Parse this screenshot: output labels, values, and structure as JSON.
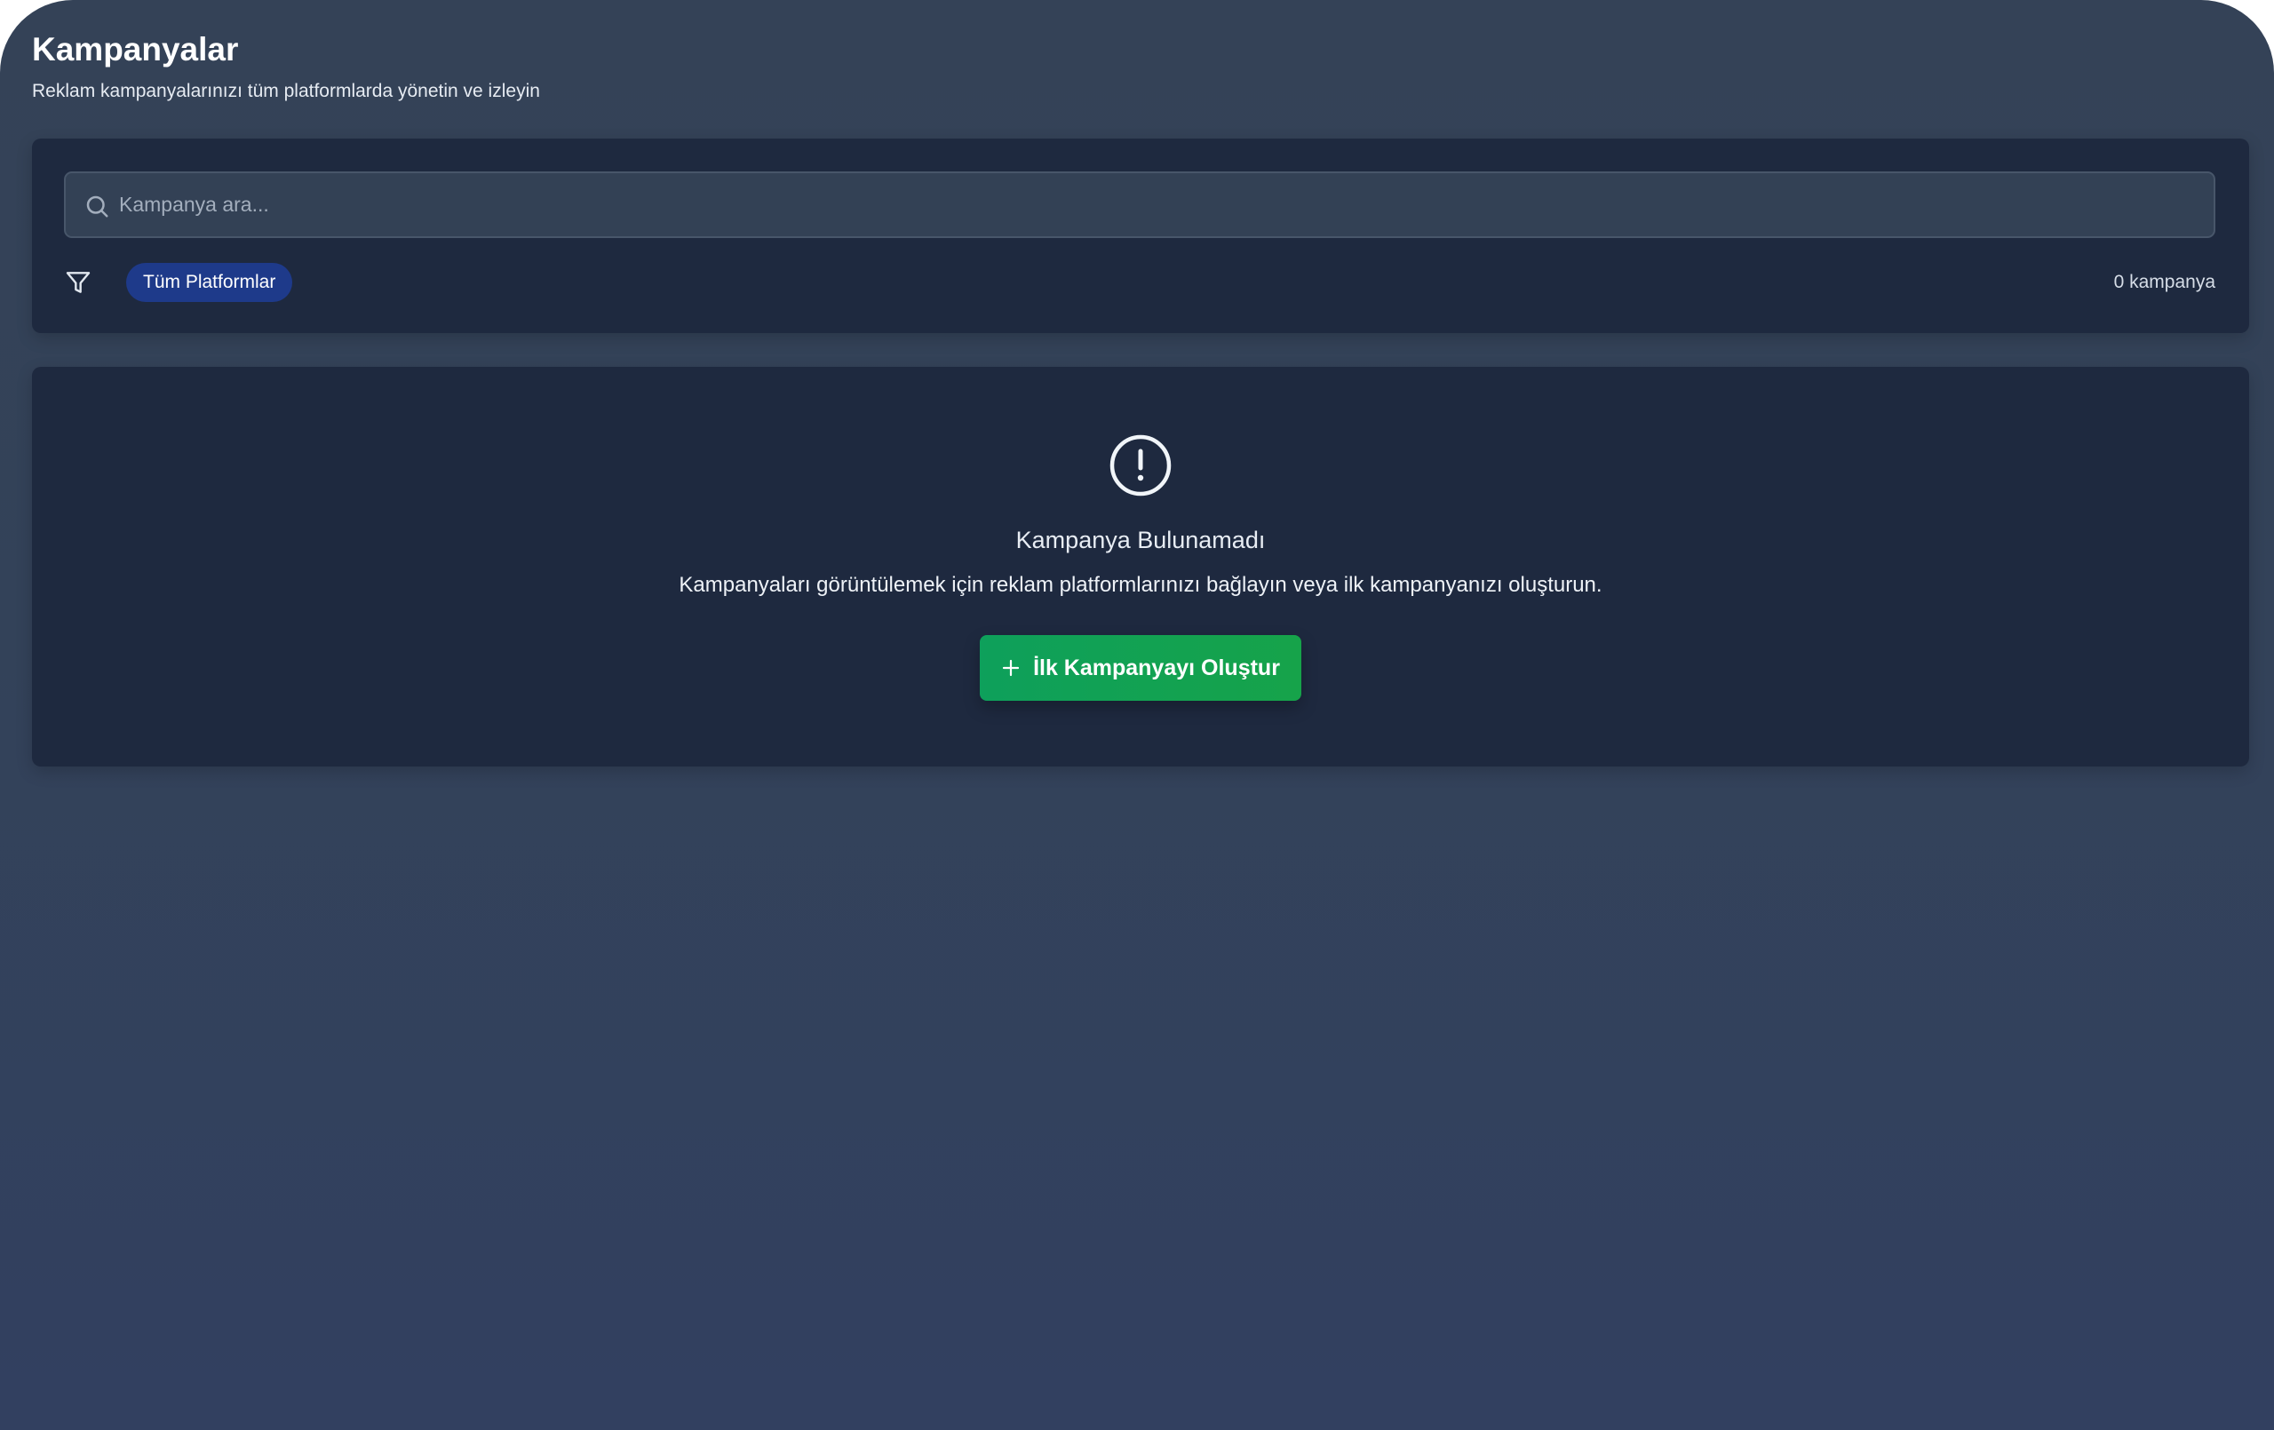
{
  "header": {
    "title": "Kampanyalar",
    "subtitle": "Reklam kampanyalarınızı tüm platformlarda yönetin ve izleyin"
  },
  "search": {
    "placeholder": "Kampanya ara...",
    "value": "",
    "icon": "search-icon"
  },
  "filters": {
    "icon": "filter-icon",
    "platform_chip": "Tüm Platformlar",
    "count_label": "0 kampanya"
  },
  "empty_state": {
    "icon": "alert-circle-icon",
    "title": "Kampanya Bulunamadı",
    "description": "Kampanyaları görüntülemek için reklam platformlarınızı bağlayın veya ilk kampanyanızı oluşturun.",
    "button_label": "İlk Kampanyayı Oluştur",
    "button_icon": "plus-icon"
  },
  "colors": {
    "background": "#344257",
    "panel": "#1e293f",
    "chip": "#1e3a8a",
    "primary_button": "#16a34a"
  }
}
